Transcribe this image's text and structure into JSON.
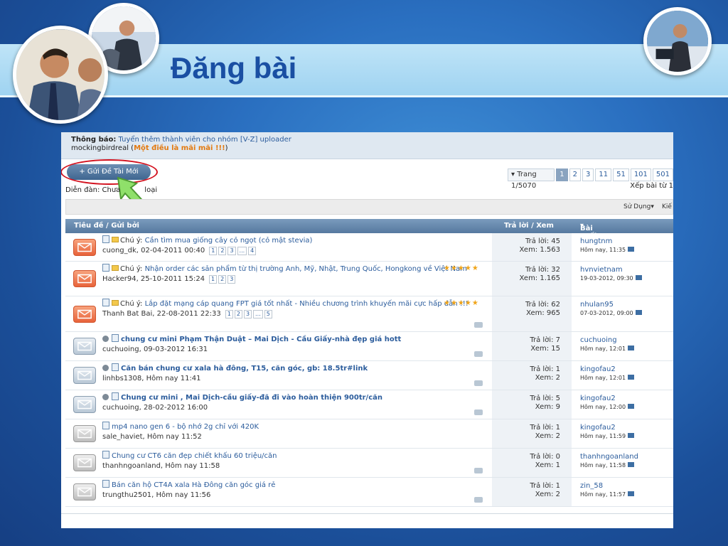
{
  "slide": {
    "title": "Đăng bài"
  },
  "notice": {
    "label": "Thông báo:",
    "link": "Tuyển thêm thành viên cho nhóm [V-Z] uploader",
    "author": "mockingbirdreal",
    "paren_open": " (",
    "quote": "Một điều là mãi mãi !!!",
    "paren_close": ")"
  },
  "toolbar": {
    "new_thread": "+ Gửi Đề Tài Mới",
    "forum_label": "Diễn đàn: Chưa",
    "forum_label_tail": "loại",
    "page_info": "▾ Trang 1/5070",
    "pages": [
      "1",
      "2",
      "3",
      "11",
      "51",
      "101",
      "501"
    ],
    "sort_label": "Xếp bài từ 1",
    "tools": "Sử Dụng▾",
    "search": "Kiế"
  },
  "table": {
    "col_title": "Tiêu đề / Gửi bởi",
    "col_stats": "Trả lời / Xem",
    "col_last": "Bài cuối",
    "rows": [
      {
        "icon": "hot",
        "prefix": "Chú ý: ",
        "title": "Cần tìm mua giống cây cỏ ngọt (cỏ mật stevia)",
        "meta": "cuong_dk, 02-04-2011 00:40",
        "pages": [
          "1",
          "2",
          "3",
          "...",
          "4"
        ],
        "replies": "Trả lời: 45",
        "views": "Xem: 1.563",
        "last_user": "hungtnm",
        "last_time": "Hôm nay, 11:35",
        "stars": "",
        "tag": false
      },
      {
        "icon": "hot",
        "prefix": "Chú ý: ",
        "title": "Nhận order các sản phẩm từ thị trường Anh, Mỹ, Nhật, Trung Quốc, Hongkong về Việt Nam",
        "meta": "Hacker94, 25-10-2011 15:24",
        "pages": [
          "1",
          "2",
          "3"
        ],
        "replies": "Trả lời: 32",
        "views": "Xem: 1.165",
        "last_user": "hvnvietnam",
        "last_time": "19-03-2012, 09:30",
        "stars": "★★★★★",
        "tag": false
      },
      {
        "icon": "hot",
        "prefix": "Chú ý: ",
        "title": "Lắp đặt mạng cáp quang FPT giá tốt nhất - Nhiều chương trình khuyến mãi cực hấp dẫn !!!",
        "meta": "Thanh Bat Bai, 22-08-2011 22:33",
        "pages": [
          "1",
          "2",
          "3",
          "...",
          "5"
        ],
        "replies": "Trả lời: 62",
        "views": "Xem: 965",
        "last_user": "nhulan95",
        "last_time": "07-03-2012, 09:00",
        "stars": "★★★★★",
        "tag": true
      },
      {
        "icon": "mid",
        "prefix": "",
        "title": "chung cư mini Phạm Thận Duật – Mai Dịch - Cầu Giấy-nhà đẹp giá hott",
        "meta": "cuchuoing, 09-03-2012 16:31",
        "pages": [],
        "replies": "Trả lời: 7",
        "views": "Xem: 15",
        "last_user": "cuchuoing",
        "last_time": "Hôm nay, 12:01",
        "stars": "",
        "tag": true,
        "bold": true
      },
      {
        "icon": "mid",
        "prefix": "",
        "title": "Căn bán chung cư xala hà đông, T15, căn góc, gb: 18.5tr#link",
        "meta": "linhbs1308, Hôm nay 11:41",
        "pages": [],
        "replies": "Trả lời: 1",
        "views": "Xem: 2",
        "last_user": "kingofau2",
        "last_time": "Hôm nay, 12:01",
        "stars": "",
        "tag": true,
        "bold": true
      },
      {
        "icon": "mid",
        "prefix": "",
        "title": "Chung cư mini , Mai Dịch-cầu giấy-đã đi vào hoàn thiện 900tr/căn",
        "meta": "cuchuoing, 28-02-2012 16:00",
        "pages": [],
        "replies": "Trả lời: 5",
        "views": "Xem: 9",
        "last_user": "kingofau2",
        "last_time": "Hôm nay, 12:00",
        "stars": "",
        "tag": true,
        "bold": true
      },
      {
        "icon": "old",
        "prefix": "",
        "title": "mp4 nano gen 6 - bộ nhớ 2g chỉ với 420K",
        "meta": "sale_haviet, Hôm nay 11:52",
        "pages": [],
        "replies": "Trả lời: 1",
        "views": "Xem: 2",
        "last_user": "kingofau2",
        "last_time": "Hôm nay, 11:59",
        "stars": "",
        "tag": false
      },
      {
        "icon": "old",
        "prefix": "",
        "title": "Chung cư CT6 căn đẹp chiết khấu 60 triệu/căn",
        "meta": "thanhngoanland, Hôm nay 11:58",
        "pages": [],
        "replies": "Trả lời: 0",
        "views": "Xem: 1",
        "last_user": "thanhngoanland",
        "last_time": "Hôm nay, 11:58",
        "stars": "",
        "tag": true
      },
      {
        "icon": "old",
        "prefix": "",
        "title": "Bán căn hộ CT4A xala Hà Đông căn góc giá rẻ",
        "meta": "trungthu2501, Hôm nay 11:56",
        "pages": [],
        "replies": "Trả lời: 1",
        "views": "Xem: 2",
        "last_user": "zin_58",
        "last_time": "Hôm nay, 11:57",
        "stars": "",
        "tag": true
      }
    ]
  },
  "colors": {
    "title_blue": "#1a4fa3",
    "link_blue": "#2b5c9c",
    "highlight_red": "#d3121f",
    "arrow_green": "#7fd35a"
  }
}
